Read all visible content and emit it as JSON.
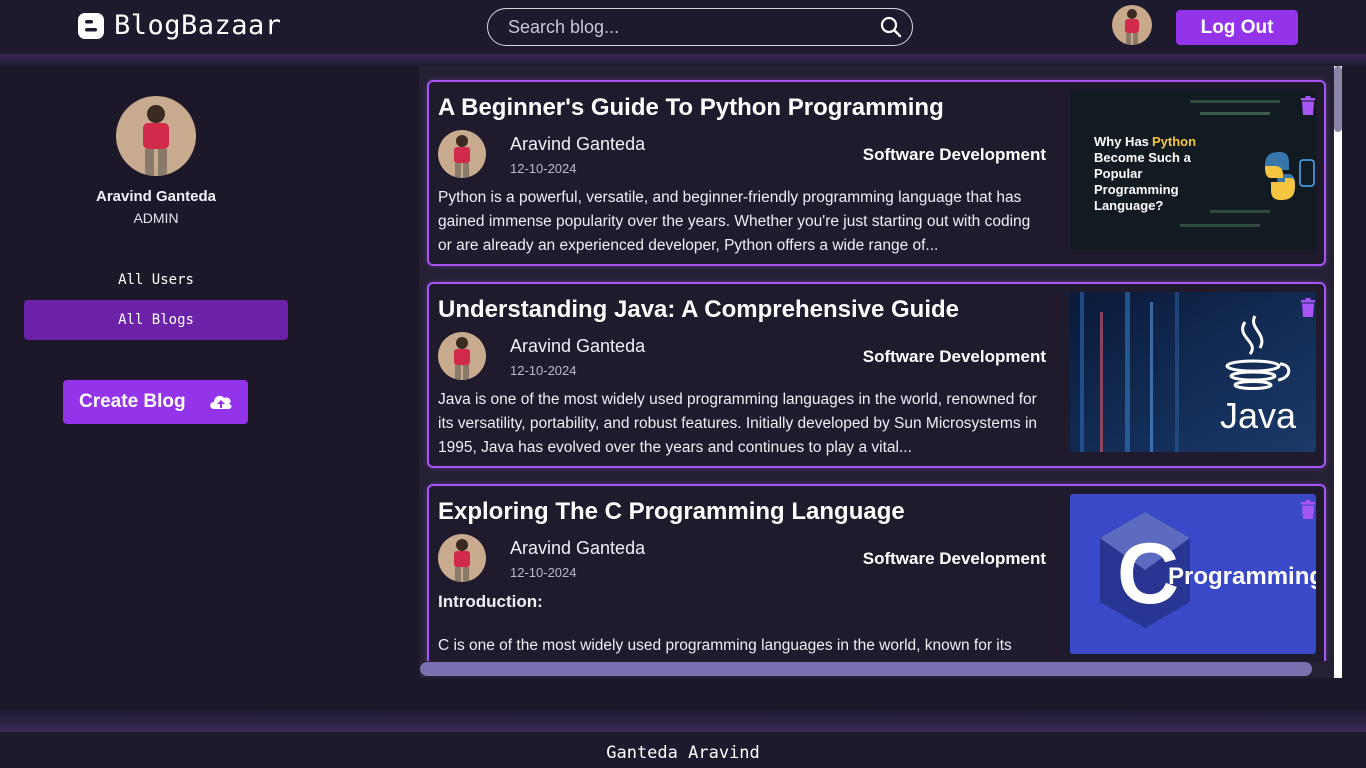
{
  "header": {
    "brand": "BlogBazaar",
    "search_placeholder": "Search blog...",
    "logout_label": "Log Out"
  },
  "sidebar": {
    "user_name": "Aravind Ganteda",
    "user_role": "ADMIN",
    "nav": [
      {
        "label": "All Users",
        "active": false
      },
      {
        "label": "All Blogs",
        "active": true
      }
    ],
    "create_label": "Create Blog"
  },
  "blogs": [
    {
      "title": "A Beginner's Guide To Python Programming",
      "author": "Aravind Ganteda",
      "date": "12-10-2024",
      "category": "Software Development",
      "excerpt": "Python is a powerful, versatile, and beginner-friendly programming language that has gained immense popularity over the years. Whether you're just starting out with coding or are already an experienced developer, Python offers a wide range of...",
      "thumb": {
        "line1": "Why Has",
        "highlight": "Python",
        "rest": [
          "Become Such a",
          "Popular",
          "Programming",
          "Language?"
        ]
      }
    },
    {
      "title": "Understanding Java: A Comprehensive Guide",
      "author": "Aravind Ganteda",
      "date": "12-10-2024",
      "category": "Software Development",
      "excerpt": "Java is one of the most widely used programming languages in the world, renowned for its versatility, portability, and robust features. Initially developed by Sun Microsystems in 1995, Java has evolved over the years and continues to play a vital...",
      "thumb": {
        "label": "Java"
      }
    },
    {
      "title": "Exploring The C Programming Language",
      "author": "Aravind Ganteda",
      "date": "12-10-2024",
      "category": "Software Development",
      "excerpt_heading": "Introduction:",
      "excerpt": "C is one of the most widely used programming languages in the world, known for its",
      "thumb": {
        "letter": "C",
        "label": "Programming"
      }
    }
  ],
  "footer": {
    "text": "Ganteda Aravind"
  },
  "colors": {
    "accent": "#9333ea",
    "card_border": "#a855f7",
    "background": "#1c1829"
  }
}
